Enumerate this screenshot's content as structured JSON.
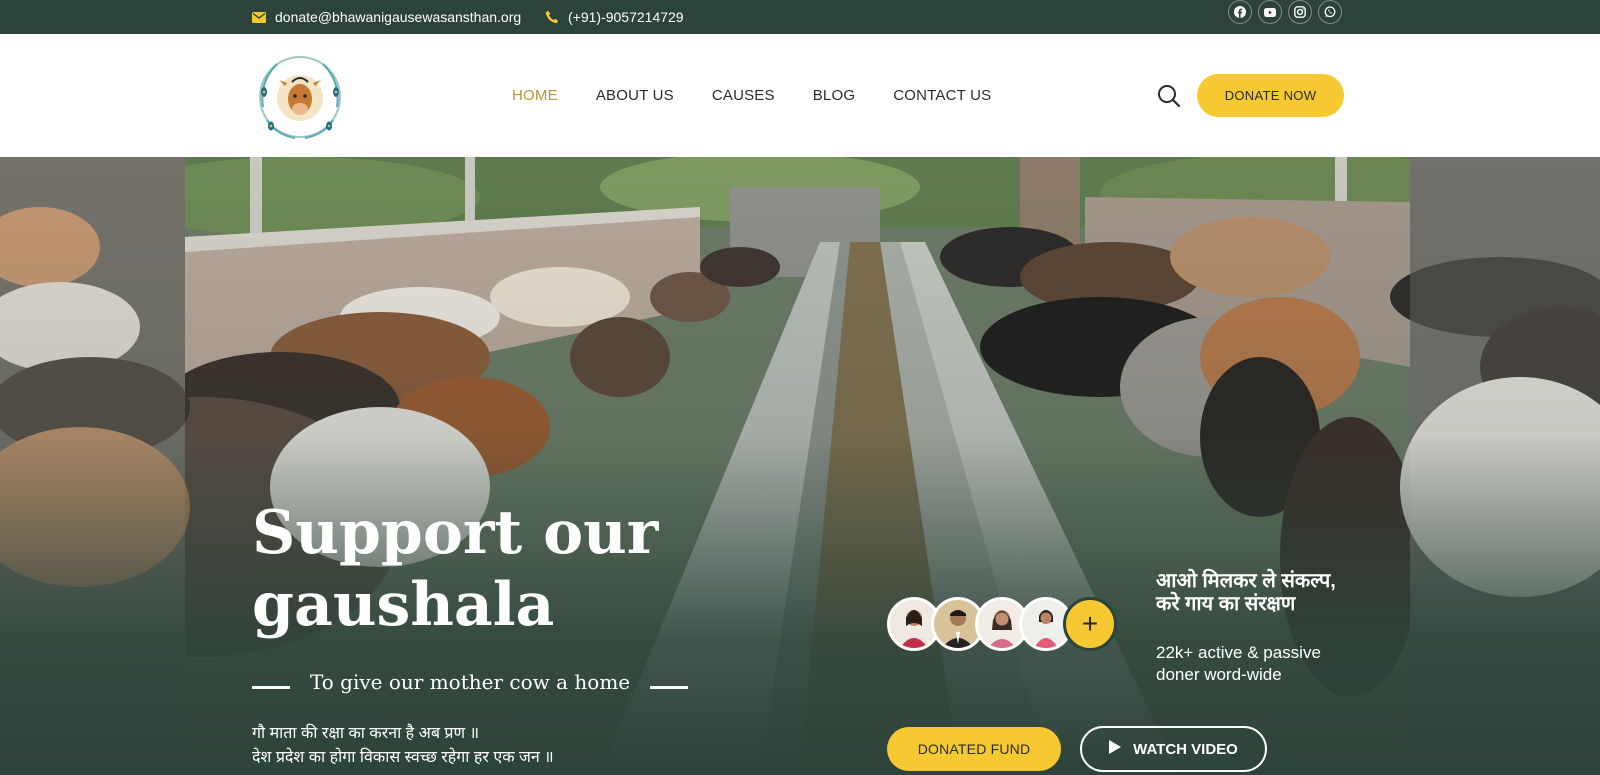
{
  "topbar": {
    "email": "donate@bhawanigausewasansthan.org",
    "phone": "(+91)-9057214729",
    "socials": [
      "facebook-icon",
      "youtube-icon",
      "instagram-icon",
      "whatsapp-icon"
    ]
  },
  "header": {
    "logo_text": "BHAWANI GAU SEWA SANSTHAN",
    "nav": [
      "HOME",
      "ABOUT US",
      "CAUSES",
      "BLOG",
      "CONTACT US"
    ],
    "active_nav": "HOME",
    "donate_label": "DONATE NOW"
  },
  "hero": {
    "title_line1": "Support our",
    "title_line2": "gaushala",
    "tagline": "To give our mother cow a home",
    "desc_line1": "गौ माता की रक्षा का करना है अब प्रण ॥",
    "desc_line2": "देश प्रदेश का होगा विकास स्वच्छ रहेगा हर एक जन ॥",
    "plus_symbol": "+",
    "pledge": "आओ मिलकर ले संकल्प, करे गाय का संरक्षण",
    "donors": "22k+ active & passive doner word-wide",
    "fund_button": "DONATED FUND",
    "video_button": "WATCH VIDEO"
  },
  "colors": {
    "dark_green": "#2c4339",
    "accent_yellow": "#f6c932",
    "nav_active": "#b8933a"
  }
}
